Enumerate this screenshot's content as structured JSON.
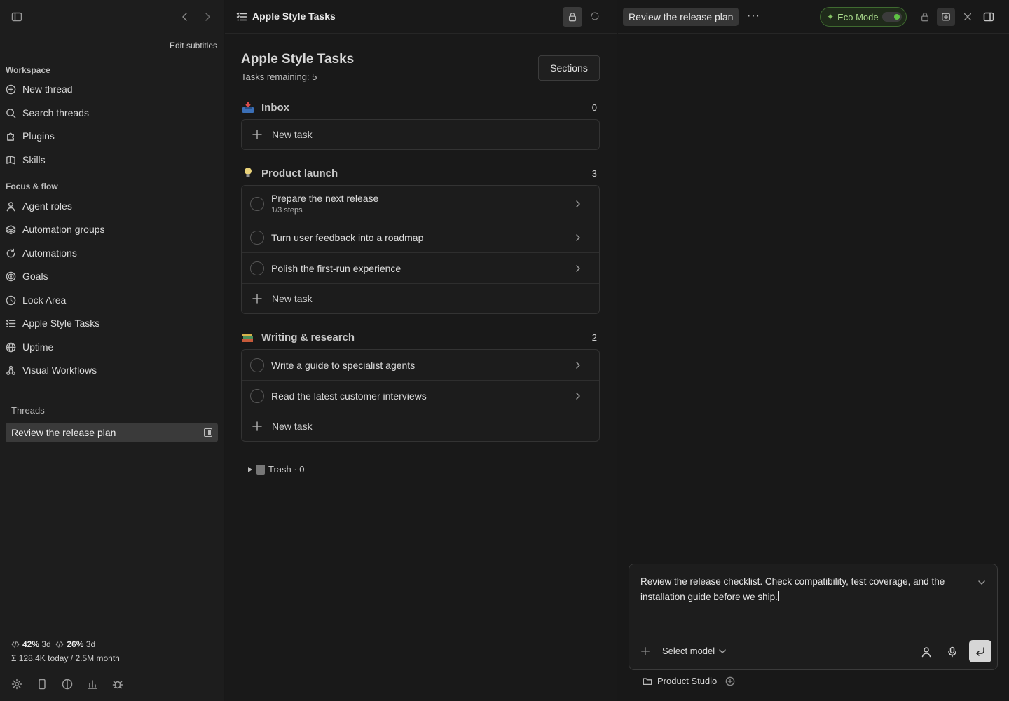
{
  "sidebar": {
    "edit_subtitles": "Edit subtitles",
    "workspace_title": "Workspace",
    "workspace_items": [
      {
        "label": "New thread",
        "icon": "plus-circle-icon"
      },
      {
        "label": "Search threads",
        "icon": "search-icon"
      },
      {
        "label": "Plugins",
        "icon": "puzzle-icon"
      },
      {
        "label": "Skills",
        "icon": "book-icon"
      }
    ],
    "focus_title": "Focus & flow",
    "focus_items": [
      {
        "label": "Agent roles",
        "icon": "user-icon"
      },
      {
        "label": "Automation groups",
        "icon": "layers-icon"
      },
      {
        "label": "Automations",
        "icon": "loop-icon"
      },
      {
        "label": "Goals",
        "icon": "target-icon"
      },
      {
        "label": "Lock Area",
        "icon": "clock-icon"
      },
      {
        "label": "Apple Style Tasks",
        "icon": "list-icon"
      },
      {
        "label": "Uptime",
        "icon": "globe-icon"
      },
      {
        "label": "Visual Workflows",
        "icon": "workflow-icon"
      }
    ],
    "threads_label": "Threads",
    "thread_items": [
      {
        "label": "Review the release plan",
        "active": true
      }
    ],
    "usage": {
      "a_pct": "42%",
      "a_period": "3d",
      "b_pct": "26%",
      "b_period": "3d",
      "tokens": "Σ 128.4K today / 2.5M month"
    }
  },
  "tasks": {
    "header_title": "Apple Style Tasks",
    "page_title": "Apple Style Tasks",
    "remaining": "Tasks remaining: 5",
    "sections_button": "Sections",
    "new_task_label": "New task",
    "groups": [
      {
        "name": "Inbox",
        "count": "0",
        "emoji": "inbox-tray",
        "tasks": []
      },
      {
        "name": "Product launch",
        "count": "3",
        "emoji": "lightbulb",
        "tasks": [
          {
            "title": "Prepare the next release",
            "sub": "1/3 steps"
          },
          {
            "title": "Turn user feedback into a roadmap",
            "sub": ""
          },
          {
            "title": "Polish the first-run experience",
            "sub": ""
          }
        ]
      },
      {
        "name": "Writing & research",
        "count": "2",
        "emoji": "books",
        "tasks": [
          {
            "title": "Write a guide to specialist agents",
            "sub": ""
          },
          {
            "title": "Read the latest customer interviews",
            "sub": ""
          }
        ]
      }
    ],
    "trash_label": "Trash · 0"
  },
  "chat": {
    "thread_title": "Review the release plan",
    "more_label": "···",
    "eco_mode_label": "Eco Mode",
    "eco_mode_on": true,
    "message": "Review the release checklist. Check compatibility, test coverage, and the installation guide before we ship.",
    "model_select": "Select model",
    "project": "Product Studio"
  },
  "colors": {
    "accent_green": "#5ec244",
    "background": "#181818",
    "sidebar": "#1d1d1d"
  }
}
